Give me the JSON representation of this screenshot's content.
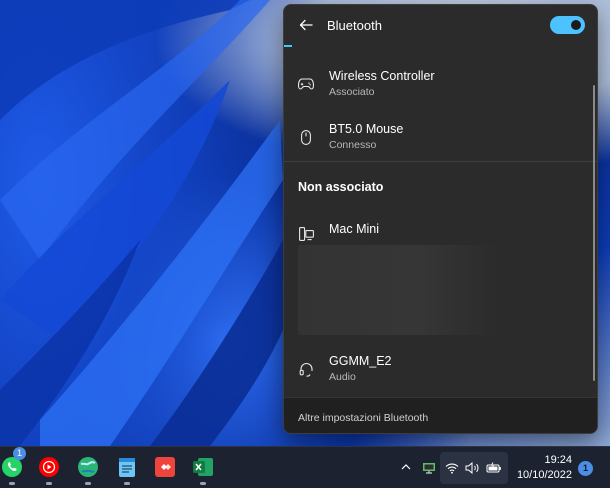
{
  "panel": {
    "title": "Bluetooth",
    "toggle_on": true,
    "paired_devices": [
      {
        "name": "Wireless Controller",
        "status": "Associato",
        "icon": "gamepad-icon"
      },
      {
        "name": "BT5.0 Mouse",
        "status": "Connesso",
        "icon": "mouse-icon"
      }
    ],
    "unpaired_label": "Non associato",
    "unpaired_devices": [
      {
        "name": "Mac Mini",
        "status": "",
        "icon": "computer-icon"
      },
      {
        "name": "GGMM_E2",
        "status": "Audio",
        "icon": "headset-icon"
      }
    ],
    "footer_link": "Altre impostazioni Bluetooth"
  },
  "taskbar": {
    "apps": [
      {
        "icon": "whatsapp-icon",
        "badge": "1"
      },
      {
        "icon": "youtube-music-icon"
      },
      {
        "icon": "browser-globe-icon"
      },
      {
        "icon": "notepad-icon"
      },
      {
        "icon": "anydesk-icon"
      },
      {
        "icon": "excel-icon"
      }
    ],
    "tray_icons": [
      "chevron-up-icon",
      "network-device-icon",
      "wifi-icon",
      "volume-icon",
      "battery-icon"
    ],
    "time": "19:24",
    "date": "10/10/2022",
    "notification_count": "1"
  },
  "colors": {
    "accent": "#4cc2ff",
    "panel_bg": "#2b2b2b",
    "taskbar_bg": "#1c2230"
  }
}
